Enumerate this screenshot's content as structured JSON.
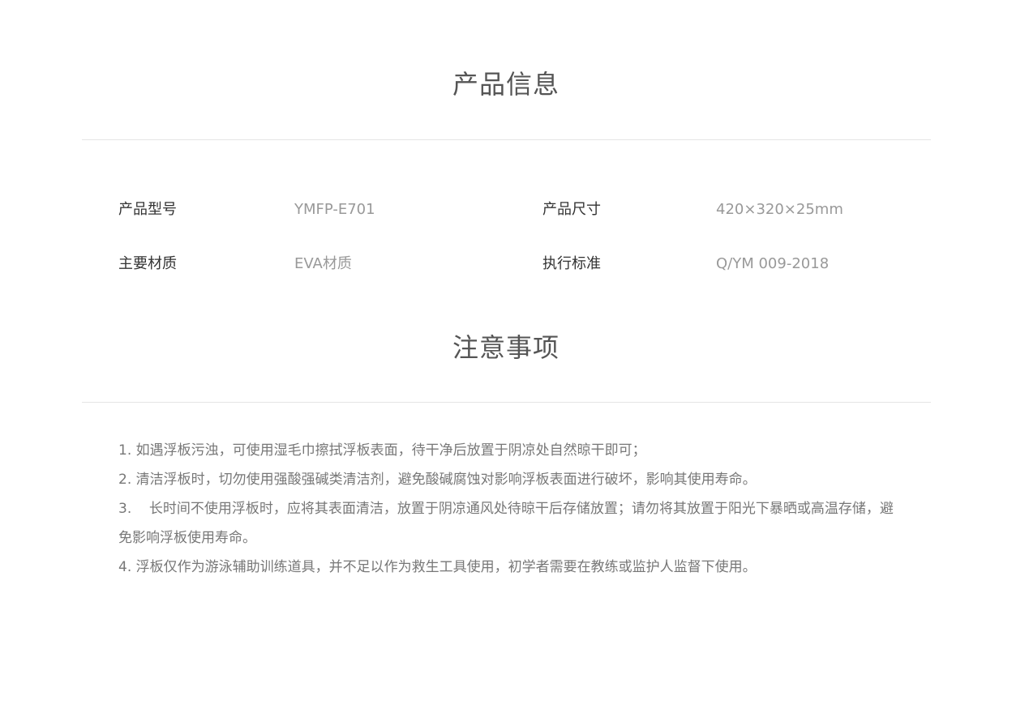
{
  "product_info": {
    "title": "产品信息",
    "specs": [
      {
        "label": "产品型号",
        "value": "YMFP-E701"
      },
      {
        "label": "产品尺寸",
        "value": "420×320×25mm"
      },
      {
        "label": "主要材质",
        "value": "EVA材质"
      },
      {
        "label": "执行标准",
        "value": "Q/YM 009-2018"
      }
    ]
  },
  "notice": {
    "title": "注意事项",
    "items": [
      "1. 如遇浮板污浊，可使用湿毛巾擦拭浮板表面，待干净后放置于阴凉处自然晾干即可；",
      "2. 清洁浮板时，切勿使用强酸强碱类清洁剂，避免酸碱腐蚀对影响浮板表面进行破坏，影响其使用寿命。",
      "3.    长时间不使用浮板时，应将其表面清洁，放置于阴凉通风处待晾干后存储放置；请勿将其放置于阳光下暴晒或高温存储，避免影响浮板使用寿命。",
      "4. 浮板仅作为游泳辅助训练道具，并不足以作为救生工具使用，初学者需要在教练或监护人监督下使用。"
    ]
  }
}
